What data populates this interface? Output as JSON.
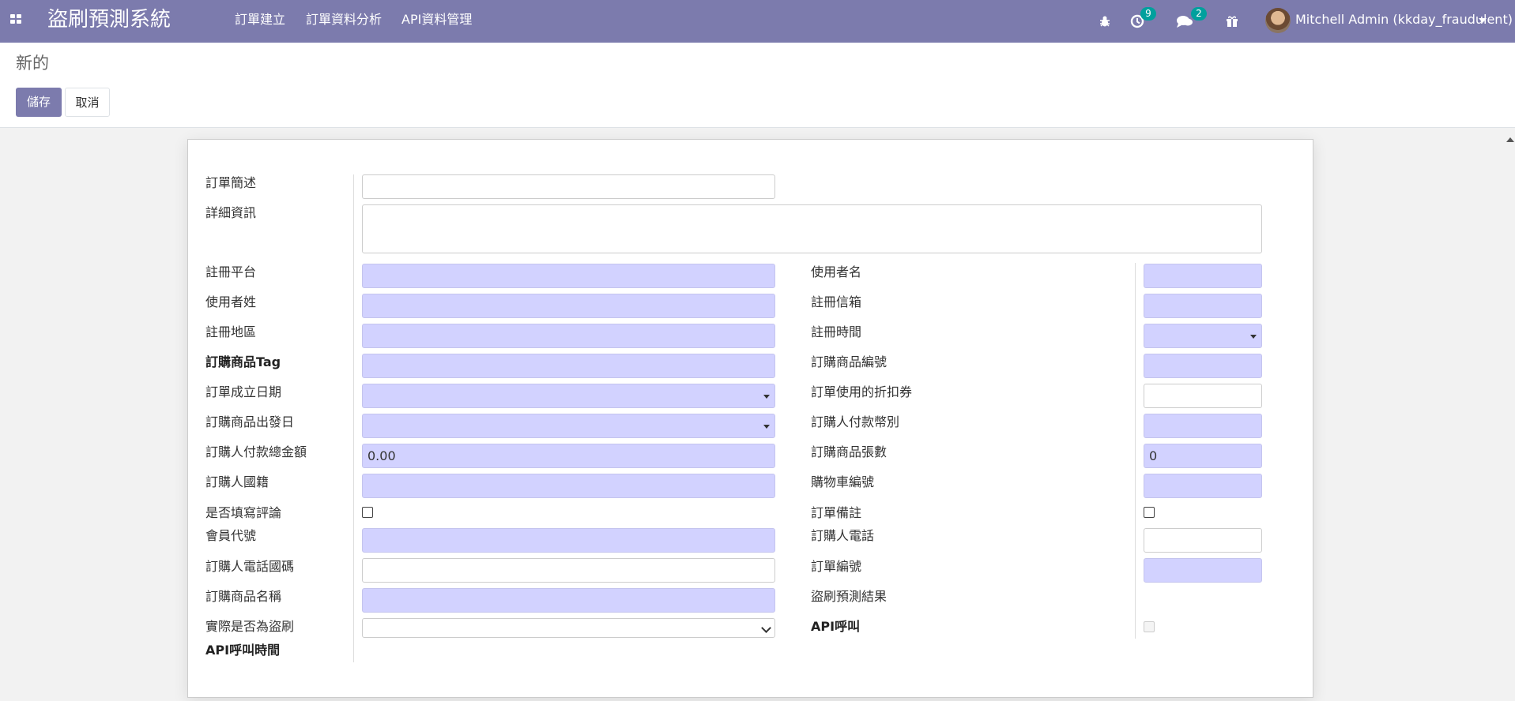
{
  "nav": {
    "brand": "盜刷預測系統",
    "menu": [
      "訂單建立",
      "訂單資料分析",
      "API資料管理"
    ],
    "activity_count": "9",
    "message_count": "2",
    "user": "Mitchell Admin (kkday_fraudulent)"
  },
  "control_panel": {
    "breadcrumb": "新的",
    "save_label": "儲存",
    "cancel_label": "取消"
  },
  "form": {
    "order_summary": "訂單簡述",
    "detail_info": "詳細資訊",
    "left": [
      "註冊平台",
      "使用者姓",
      "註冊地區",
      "訂購商品Tag",
      "訂單成立日期",
      "訂購商品出發日",
      "訂購人付款總金額",
      "訂購人國籍",
      "是否填寫評論",
      "會員代號",
      "訂購人電話國碼",
      "訂購商品名稱",
      "實際是否為盜刷",
      "API呼叫時間"
    ],
    "right": [
      "使用者名",
      "註冊信箱",
      "註冊時間",
      "訂購商品編號",
      "訂單使用的折扣券",
      "訂購人付款幣別",
      "訂購商品張數",
      "購物車編號",
      "訂單備註",
      "訂購人電話",
      "訂單編號",
      "盜刷預測結果",
      "API呼叫"
    ],
    "amount_value": "0.00",
    "ticket_count_value": "0"
  },
  "colors": {
    "navbar": "#7c7bad",
    "required_field": "#d2d2ff",
    "badge": "#00a09d"
  }
}
